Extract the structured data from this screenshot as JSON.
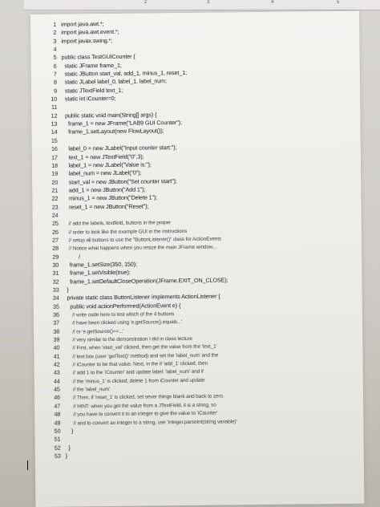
{
  "ruler": {
    "ticks": [
      "2",
      "3",
      "4",
      "5"
    ]
  },
  "code_lines": [
    {
      "n": "1",
      "t": "import java.awt.*;"
    },
    {
      "n": "2",
      "t": "import java.awt.event.*;"
    },
    {
      "n": "3",
      "t": "import javax.swing.*;"
    },
    {
      "n": "4",
      "t": ""
    },
    {
      "n": "5",
      "t": "public class TestGUICounter {"
    },
    {
      "n": "6",
      "t": "  static JFrame frame_1;"
    },
    {
      "n": "7",
      "t": "  static JButton start_val, add_1, minus_1, reset_1;"
    },
    {
      "n": "8",
      "t": "  static JLabel label_0, label_1, label_num;"
    },
    {
      "n": "9",
      "t": "  static JTextField text_1;"
    },
    {
      "n": "10",
      "t": "  static int iCounter=0;"
    },
    {
      "n": "11",
      "t": ""
    },
    {
      "n": "12",
      "t": "  public static void main(String[] args) {"
    },
    {
      "n": "13",
      "t": "    frame_1 = new JFrame(\"LAB9 GUI Counter\");"
    },
    {
      "n": "14",
      "t": "    frame_1.setLayout(new FlowLayout());"
    },
    {
      "n": "15",
      "t": ""
    },
    {
      "n": "16",
      "t": "    label_0 = new JLabel(\"Input counter start:\");"
    },
    {
      "n": "17",
      "t": "    text_1 = new JTextField(\"0\",3);"
    },
    {
      "n": "18",
      "t": "    label_1 = new JLabel(\"Value is:\");"
    },
    {
      "n": "19",
      "t": "    label_num = new JLabel(\"0\");"
    },
    {
      "n": "20",
      "t": "    start_val = new JButton(\"Set counter start\");"
    },
    {
      "n": "21",
      "t": "    add_1 = new JButton(\"Add 1\");"
    },
    {
      "n": "22",
      "t": "    minus_1 = new JButton(\"Delete 1\");"
    },
    {
      "n": "23",
      "t": "    reset_1 = new JButton(\"Reset\");"
    },
    {
      "n": "24",
      "t": ""
    },
    {
      "n": "25",
      "t": "    // add the labels, textfield, buttons in the proper",
      "c": true
    },
    {
      "n": "26",
      "t": "    // order to look like the example GUI in the instructions",
      "c": true
    },
    {
      "n": "27",
      "t": "    // setup all buttons to use the \"ButtonListener()\" class for ActionEvents",
      "c": true
    },
    {
      "n": "28",
      "t": "    // Notice what happens when you resize the main JFrame window...",
      "c": true
    },
    {
      "n": "29",
      "t": "          /"
    },
    {
      "n": "30",
      "t": "    frame_1.setSize(350, 150);"
    },
    {
      "n": "31",
      "t": "    frame_1.setVisible(true);"
    },
    {
      "n": "32",
      "t": "    frame_1.setDefaultCloseOperation(JFrame.EXIT_ON_CLOSE);"
    },
    {
      "n": "33",
      "t": "  }"
    },
    {
      "n": "34",
      "t": "  private static class ButtonListener implements ActionListener {"
    },
    {
      "n": "35",
      "t": "    public void actionPerformed(ActionEvent e) {"
    },
    {
      "n": "36",
      "t": "      // write code here to test which of the 4 buttons",
      "c": true
    },
    {
      "n": "37",
      "t": "      // have been clicked using 'e.getSource().equals...'",
      "c": true
    },
    {
      "n": "38",
      "t": "      // or 'e.getSource()==...'",
      "c": true
    },
    {
      "n": "39",
      "t": "      // very similar to the demonstration I did in class lecture",
      "c": true
    },
    {
      "n": "40",
      "t": "      // First, when 'start_val' clicked, then get the value from the 'text_1'",
      "c": true
    },
    {
      "n": "41",
      "t": "      // text box (user 'getText()' method) and set the 'label_num' and the",
      "c": true
    },
    {
      "n": "42",
      "t": "      // iCounter to be that value. Next, in the if 'add_1' clicked, then",
      "c": true
    },
    {
      "n": "43",
      "t": "      // add 1 to the 'iCounter' and update label: 'label_num' and if",
      "c": true
    },
    {
      "n": "44",
      "t": "      // the 'minus_1' is clicked, delete 1 from iCounter and update",
      "c": true
    },
    {
      "n": "45",
      "t": "      // the 'label_num'",
      "c": true
    },
    {
      "n": "46",
      "t": "      // Then, if 'reset_1' is clicked, set sever things blank and back to zero.",
      "c": true
    },
    {
      "n": "47",
      "t": "      // HINT: when you get the value from a JTextField, it is a string, so",
      "c": true
    },
    {
      "n": "48",
      "t": "      // you have to convert it to an integer to give the value to 'iCounter'",
      "c": true
    },
    {
      "n": "49",
      "t": "      // and to convert an integer to a string, use 'Integer.parseInt(string variable)'",
      "c": true
    },
    {
      "n": "50",
      "t": "    }"
    },
    {
      "n": "51",
      "t": ""
    },
    {
      "n": "52",
      "t": "  }"
    },
    {
      "n": "53",
      "t": "}"
    }
  ]
}
